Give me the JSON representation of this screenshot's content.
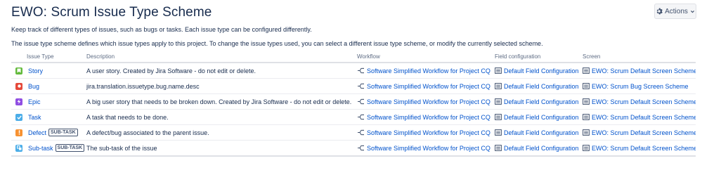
{
  "header": {
    "title": "EWO: Scrum Issue Type Scheme",
    "actions_label": "Actions"
  },
  "intro": {
    "line1": "Keep track of different types of issues, such as bugs or tasks. Each issue type can be configured differently.",
    "line2": "The issue type scheme defines which issue types apply to this project. To change the issue types used, you can select a different issue type scheme, or modify the currently selected scheme."
  },
  "table": {
    "columns": {
      "issue_type": "Issue Type",
      "description": "Description",
      "workflow": "Workflow",
      "field_configuration": "Field configuration",
      "screen": "Screen"
    },
    "rows": [
      {
        "name": "Story",
        "icon": "story-icon",
        "color": "#63ba3c",
        "badge": "",
        "description": "A user story. Created by Jira Software - do not edit or delete.",
        "workflow": "Software Simplified Workflow for Project CQ",
        "field_config": "Default Field Configuration",
        "screen": "EWO: Scrum Default Screen Scheme"
      },
      {
        "name": "Bug",
        "icon": "bug-icon",
        "color": "#e5493a",
        "badge": "",
        "description": "jira.translation.issuetype.bug.name.desc",
        "workflow": "Software Simplified Workflow for Project CQ",
        "field_config": "Default Field Configuration",
        "screen": "EWO: Scrum Bug Screen Scheme"
      },
      {
        "name": "Epic",
        "icon": "epic-icon",
        "color": "#904ee2",
        "badge": "",
        "description": "A big user story that needs to be broken down. Created by Jira Software - do not edit or delete.",
        "workflow": "Software Simplified Workflow for Project CQ",
        "field_config": "Default Field Configuration",
        "screen": "EWO: Scrum Default Screen Scheme"
      },
      {
        "name": "Task",
        "icon": "task-icon",
        "color": "#4bade8",
        "badge": "",
        "description": "A task that needs to be done.",
        "workflow": "Software Simplified Workflow for Project CQ",
        "field_config": "Default Field Configuration",
        "screen": "EWO: Scrum Default Screen Scheme"
      },
      {
        "name": "Defect",
        "icon": "defect-icon",
        "color": "#f79232",
        "badge": "SUB-TASK",
        "description": "A defect/bug associated to the parent issue.",
        "workflow": "Software Simplified Workflow for Project CQ",
        "field_config": "Default Field Configuration",
        "screen": "EWO: Scrum Default Screen Scheme"
      },
      {
        "name": "Sub-task",
        "icon": "subtask-icon",
        "color": "#4bade8",
        "badge": "SUB-TASK",
        "description": "The sub-task of the issue",
        "workflow": "Software Simplified Workflow for Project CQ",
        "field_config": "Default Field Configuration",
        "screen": "EWO: Scrum Default Screen Scheme"
      }
    ]
  }
}
